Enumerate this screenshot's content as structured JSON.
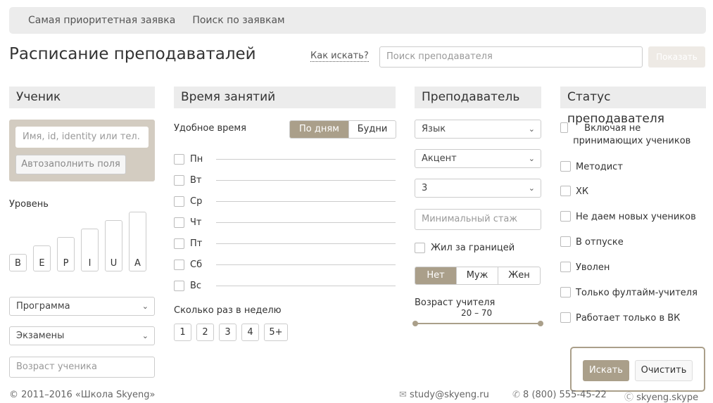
{
  "nav": {
    "items": [
      "Самая приоритетная заявка",
      "Поиск по заявкам"
    ]
  },
  "header": {
    "title": "Расписание преподаваталей",
    "how_to": "Как искать?",
    "search_placeholder": "Поиск преподавателя",
    "show_button": "Показать"
  },
  "student": {
    "heading": "Ученик",
    "input_placeholder": "Имя, id, identity или тел.",
    "autofill": "Автозаполнить поля",
    "level_label": "Уровень",
    "levels": [
      "B",
      "E",
      "P",
      "I",
      "U",
      "A"
    ],
    "program": "Программа",
    "exams": "Экзамены",
    "age_placeholder": "Возраст ученика"
  },
  "time": {
    "heading": "Время занятий",
    "convenient": "Удобное время",
    "toggle": [
      "По дням",
      "Будни"
    ],
    "days": [
      "Пн",
      "Вт",
      "Ср",
      "Чт",
      "Пт",
      "Сб",
      "Вс"
    ],
    "per_week_label": "Сколько раз в неделю",
    "per_week": [
      "1",
      "2",
      "3",
      "4",
      "5+"
    ]
  },
  "teacher": {
    "heading": "Преподаватель",
    "language": "Язык",
    "accent": "Акцент",
    "third": "3",
    "experience_placeholder": "Минимальный стаж",
    "abroad": "Жил за границей",
    "gender": [
      "Нет",
      "Муж",
      "Жен"
    ],
    "age_label": "Возраст учителя",
    "age_range": "20 – 70"
  },
  "status": {
    "heading": "Статус преподавателя",
    "items": [
      "Включая не принимающих учеников",
      "Методист",
      "ХК",
      "Не даем новых учеников",
      "В отпуске",
      "Уволен",
      "Только фултайм-учителя",
      "Работает только в ВК"
    ]
  },
  "actions": {
    "search": "Искать",
    "clear": "Очистить"
  },
  "footer": {
    "copyright": "© 2011–2016 «Школа Skyeng»",
    "email": "study@skyeng.ru",
    "phone": "8 (800) 555-45-22",
    "skype": "skyeng.skype"
  }
}
